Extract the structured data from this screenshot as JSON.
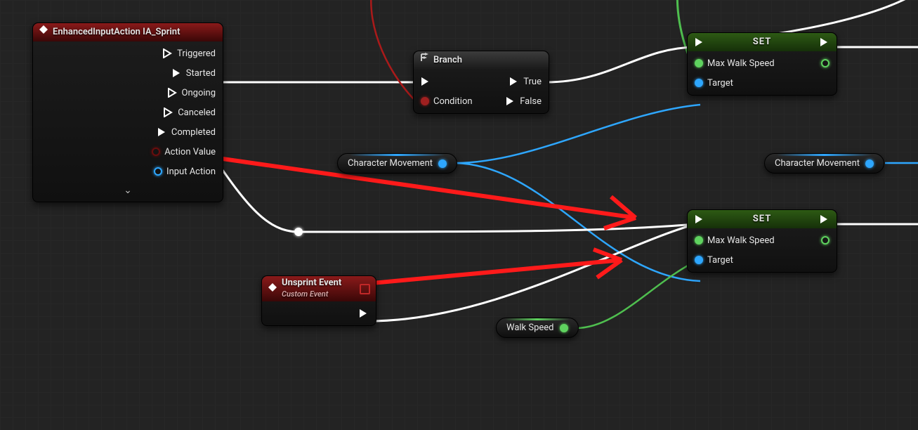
{
  "nodes": {
    "inputAction": {
      "title": "EnhancedInputAction IA_Sprint",
      "pins": [
        "Triggered",
        "Started",
        "Ongoing",
        "Canceled",
        "Completed",
        "Action Value",
        "Input Action"
      ]
    },
    "branch": {
      "title": "Branch",
      "condition": "Condition",
      "true": "True",
      "false": "False"
    },
    "set1": {
      "title": "SET",
      "maxWalk": "Max Walk Speed",
      "target": "Target"
    },
    "set2": {
      "title": "SET",
      "maxWalk": "Max Walk Speed",
      "target": "Target"
    },
    "unsprint": {
      "title": "Unsprint Event",
      "subtitle": "Custom Event"
    }
  },
  "pills": {
    "charMove1": "Character Movement",
    "charMove2": "Character Movement",
    "walkSpeed": "Walk Speed"
  },
  "colors": {
    "exec": "#ffffff",
    "float": "#5fd35f",
    "object": "#2ea7ff",
    "bool": "#a02020",
    "annotationArrow": "#ff1a1a"
  }
}
